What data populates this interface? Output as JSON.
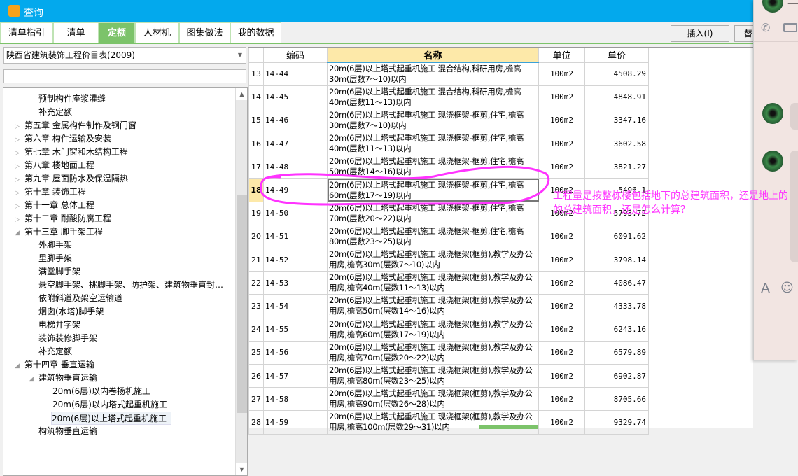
{
  "window": {
    "title": "查询",
    "logo": "广"
  },
  "tabs": [
    {
      "label": "清单指引"
    },
    {
      "label": "清单"
    },
    {
      "label": "定额",
      "active": true
    },
    {
      "label": "人材机"
    },
    {
      "label": "图集做法"
    },
    {
      "label": "我的数据"
    }
  ],
  "toolbar": {
    "insert_label": "插入(I)",
    "replace_label": "替"
  },
  "library": {
    "selected": "陕西省建筑装饰工程价目表(2009)",
    "search_value": ""
  },
  "tree": [
    {
      "label": "预制构件座浆灌缝",
      "level": 2
    },
    {
      "label": "补充定额",
      "level": 2
    },
    {
      "label": "第五章 金属构件制作及钢门窗",
      "level": 1,
      "state": "collapsed"
    },
    {
      "label": "第六章 构件运输及安装",
      "level": 1,
      "state": "collapsed"
    },
    {
      "label": "第七章 木门窗和木结构工程",
      "level": 1,
      "state": "collapsed"
    },
    {
      "label": "第八章 楼地面工程",
      "level": 1,
      "state": "collapsed"
    },
    {
      "label": "第九章 屋面防水及保温隔热",
      "level": 1,
      "state": "collapsed"
    },
    {
      "label": "第十章 装饰工程",
      "level": 1,
      "state": "collapsed"
    },
    {
      "label": "第十一章 总体工程",
      "level": 1,
      "state": "collapsed"
    },
    {
      "label": "第十二章 耐酸防腐工程",
      "level": 1,
      "state": "collapsed"
    },
    {
      "label": "第十三章 脚手架工程",
      "level": 1,
      "state": "expanded"
    },
    {
      "label": "外脚手架",
      "level": 2
    },
    {
      "label": "里脚手架",
      "level": 2
    },
    {
      "label": "满堂脚手架",
      "level": 2
    },
    {
      "label": "悬空脚手架、挑脚手架、防护架、建筑物垂直封…",
      "level": 2
    },
    {
      "label": "依附斜道及架空运输道",
      "level": 2
    },
    {
      "label": "烟囱(水塔)脚手架",
      "level": 2
    },
    {
      "label": "电梯井字架",
      "level": 2
    },
    {
      "label": "装饰装修脚手架",
      "level": 2
    },
    {
      "label": "补充定额",
      "level": 2
    },
    {
      "label": "第十四章 垂直运输",
      "level": 1,
      "state": "expanded"
    },
    {
      "label": "建筑物垂直运输",
      "level": 2,
      "state": "expanded"
    },
    {
      "label": "20m(6层)以内卷扬机施工",
      "level": 3
    },
    {
      "label": "20m(6层)以内塔式起重机施工",
      "level": 3
    },
    {
      "label": "20m(6层)以上塔式起重机施工",
      "level": 3,
      "selected": true
    },
    {
      "label": "构筑物垂直运输",
      "level": 2
    }
  ],
  "table": {
    "headers": {
      "num": "",
      "code": "编码",
      "name": "名称",
      "unit": "单位",
      "price": "单价"
    },
    "rows": [
      {
        "num": "13",
        "code": "14-44",
        "name": "20m(6层)以上塔式起重机施工 混合结构,科研用房,檐高30m(层数7～10)以内",
        "unit": "100m2",
        "price": "4508.29"
      },
      {
        "num": "14",
        "code": "14-45",
        "name": "20m(6层)以上塔式起重机施工 混合结构,科研用房,檐高40m(层数11～13)以内",
        "unit": "100m2",
        "price": "4848.91"
      },
      {
        "num": "15",
        "code": "14-46",
        "name": "20m(6层)以上塔式起重机施工 现浇框架-框剪,住宅,檐高30m(层数7～10)以内",
        "unit": "100m2",
        "price": "3347.16"
      },
      {
        "num": "16",
        "code": "14-47",
        "name": "20m(6层)以上塔式起重机施工 现浇框架-框剪,住宅,檐高40m(层数11～13)以内",
        "unit": "100m2",
        "price": "3602.58"
      },
      {
        "num": "17",
        "code": "14-48",
        "name": "20m(6层)以上塔式起重机施工 现浇框架-框剪,住宅,檐高50m(层数14～16)以内",
        "unit": "100m2",
        "price": "3821.27"
      },
      {
        "num": "18",
        "code": "14-49",
        "name": "20m(6层)以上塔式起重机施工 现浇框架-框剪,住宅,檐高60m(层数17～19)以内",
        "unit": "100m2",
        "price": "5496.1",
        "current": true
      },
      {
        "num": "19",
        "code": "14-50",
        "name": "20m(6层)以上塔式起重机施工 现浇框架-框剪,住宅,檐高70m(层数20～22)以内",
        "unit": "100m2",
        "price": "5793.72"
      },
      {
        "num": "20",
        "code": "14-51",
        "name": "20m(6层)以上塔式起重机施工 现浇框架-框剪,住宅,檐高80m(层数23～25)以内",
        "unit": "100m2",
        "price": "6091.62"
      },
      {
        "num": "21",
        "code": "14-52",
        "name": "20m(6层)以上塔式起重机施工 现浇框架(框剪),教学及办公用房,檐高30m(层数7～10)以内",
        "unit": "100m2",
        "price": "3798.14"
      },
      {
        "num": "22",
        "code": "14-53",
        "name": "20m(6层)以上塔式起重机施工 现浇框架(框剪),教学及办公用房,檐高40m(层数11～13)以内",
        "unit": "100m2",
        "price": "4086.47"
      },
      {
        "num": "23",
        "code": "14-54",
        "name": "20m(6层)以上塔式起重机施工 现浇框架(框剪),教学及办公用房,檐高50m(层数14～16)以内",
        "unit": "100m2",
        "price": "4333.78"
      },
      {
        "num": "24",
        "code": "14-55",
        "name": "20m(6层)以上塔式起重机施工 现浇框架(框剪),教学及办公用房,檐高60m(层数17～19)以内",
        "unit": "100m2",
        "price": "6243.16"
      },
      {
        "num": "25",
        "code": "14-56",
        "name": "20m(6层)以上塔式起重机施工 现浇框架(框剪),教学及办公用房,檐高70m(层数20～22)以内",
        "unit": "100m2",
        "price": "6579.89"
      },
      {
        "num": "26",
        "code": "14-57",
        "name": "20m(6层)以上塔式起重机施工 现浇框架(框剪),教学及办公用房,檐高80m(层数23～25)以内",
        "unit": "100m2",
        "price": "6902.87"
      },
      {
        "num": "27",
        "code": "14-58",
        "name": "20m(6层)以上塔式起重机施工 现浇框架(框剪),教学及办公用房,檐高90m(层数26～28)以内",
        "unit": "100m2",
        "price": "8705.66"
      },
      {
        "num": "28",
        "code": "14-59",
        "name": "20m(6层)以上塔式起重机施工 现浇框架(框剪),教学及办公用房,檐高100m(层数29～31)以内",
        "unit": "100m2",
        "price": "9329.74"
      }
    ]
  },
  "annotation": {
    "line1": "工程量是按整栋楼包括地下的总建筑面积，还是地上的",
    "line2": "的总建筑面积，还是怎么计算？",
    "color": "#ff33ff"
  },
  "chat": {
    "icons": [
      "phone-icon",
      "video-icon",
      "font-icon",
      "emoji-icon"
    ],
    "partial_text": "一"
  }
}
